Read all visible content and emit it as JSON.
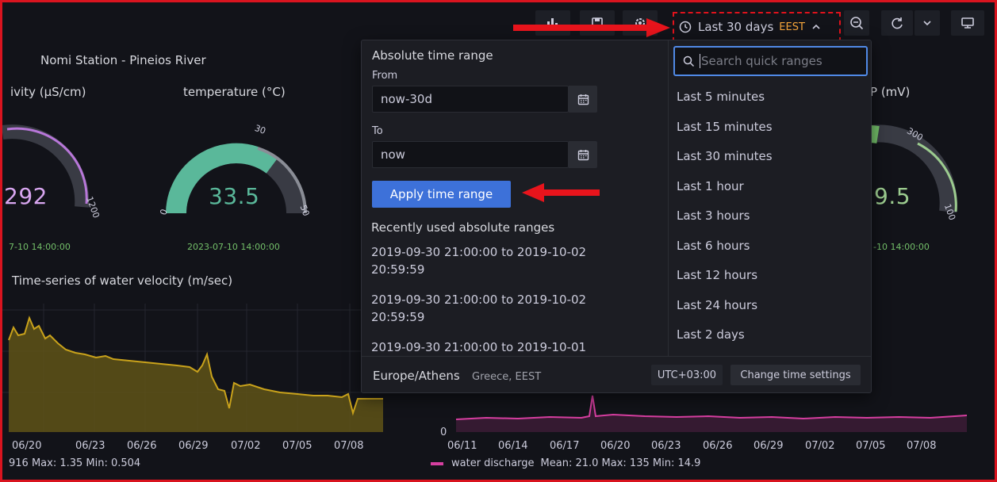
{
  "toolbar": {
    "time_range_label": "Last 30 days",
    "timezone_badge": "EEST",
    "colors": {
      "accent": "#3d71d9",
      "highlight_border": "#e0121c",
      "timezone": "#f5a53b"
    }
  },
  "dashboard": {
    "station_title": "Nomi Station - Pineios River",
    "gauges": [
      {
        "title": "ivity (μS/cm)",
        "value": "292",
        "max_tick": "1200",
        "timestamp": "7-10 14:00:00",
        "color": "#b877d9"
      },
      {
        "title": "temperature (°C)",
        "value": "33.5",
        "min_tick": "0",
        "threshold_tick": "30",
        "max_tick": "50",
        "timestamp": "2023-07-10 14:00:00",
        "color": "#5ab89a"
      },
      {
        "title": "P (mV)",
        "value": "9.5",
        "threshold_tick": "300",
        "max_tick": "100",
        "timestamp": "-10 14:00:00",
        "color": "#9ccc8f"
      }
    ],
    "velocity_panel": {
      "title": "Time-series of water velocity (m/sec)",
      "x_ticks": [
        "06/20",
        "06/23",
        "06/26",
        "06/29",
        "07/02",
        "07/05",
        "07/08"
      ],
      "legend_text": "916  Max: 1.35  Min: 0.504",
      "color": "#c9a21b"
    },
    "discharge_panel": {
      "y_zero": "0",
      "x_ticks": [
        "06/11",
        "06/14",
        "06/17",
        "06/20",
        "06/23",
        "06/26",
        "06/29",
        "07/02",
        "07/05",
        "07/08"
      ],
      "legend_name": "water discharge",
      "legend_stats": "Mean: 21.0  Max: 135  Min: 14.9",
      "color": "#d63fa0"
    }
  },
  "picker": {
    "absolute_title": "Absolute time range",
    "from_label": "From",
    "from_value": "now-30d",
    "to_label": "To",
    "to_value": "now",
    "apply_label": "Apply time range",
    "recent_title": "Recently used absolute ranges",
    "recent": [
      "2019-09-30 21:00:00 to 2019-10-02 20:59:59",
      "2019-09-30 21:00:00 to 2019-10-02 20:59:59",
      "2019-09-30 21:00:00 to 2019-10-01"
    ],
    "search_placeholder": "Search quick ranges",
    "quick_ranges": [
      "Last 5 minutes",
      "Last 15 minutes",
      "Last 30 minutes",
      "Last 1 hour",
      "Last 3 hours",
      "Last 6 hours",
      "Last 12 hours",
      "Last 24 hours",
      "Last 2 days"
    ],
    "timezone_name": "Europe/Athens",
    "timezone_detail": "Greece, EEST",
    "utc_offset": "UTC+03:00",
    "change_settings_label": "Change time settings"
  },
  "icons": [
    "chart-add-icon",
    "save-icon",
    "settings-icon",
    "clock-icon",
    "chevron-up-icon",
    "zoom-out-icon",
    "refresh-icon",
    "chevron-down-icon",
    "tv-mode-icon",
    "calendar-icon",
    "search-icon",
    "red-arrow-icon"
  ]
}
